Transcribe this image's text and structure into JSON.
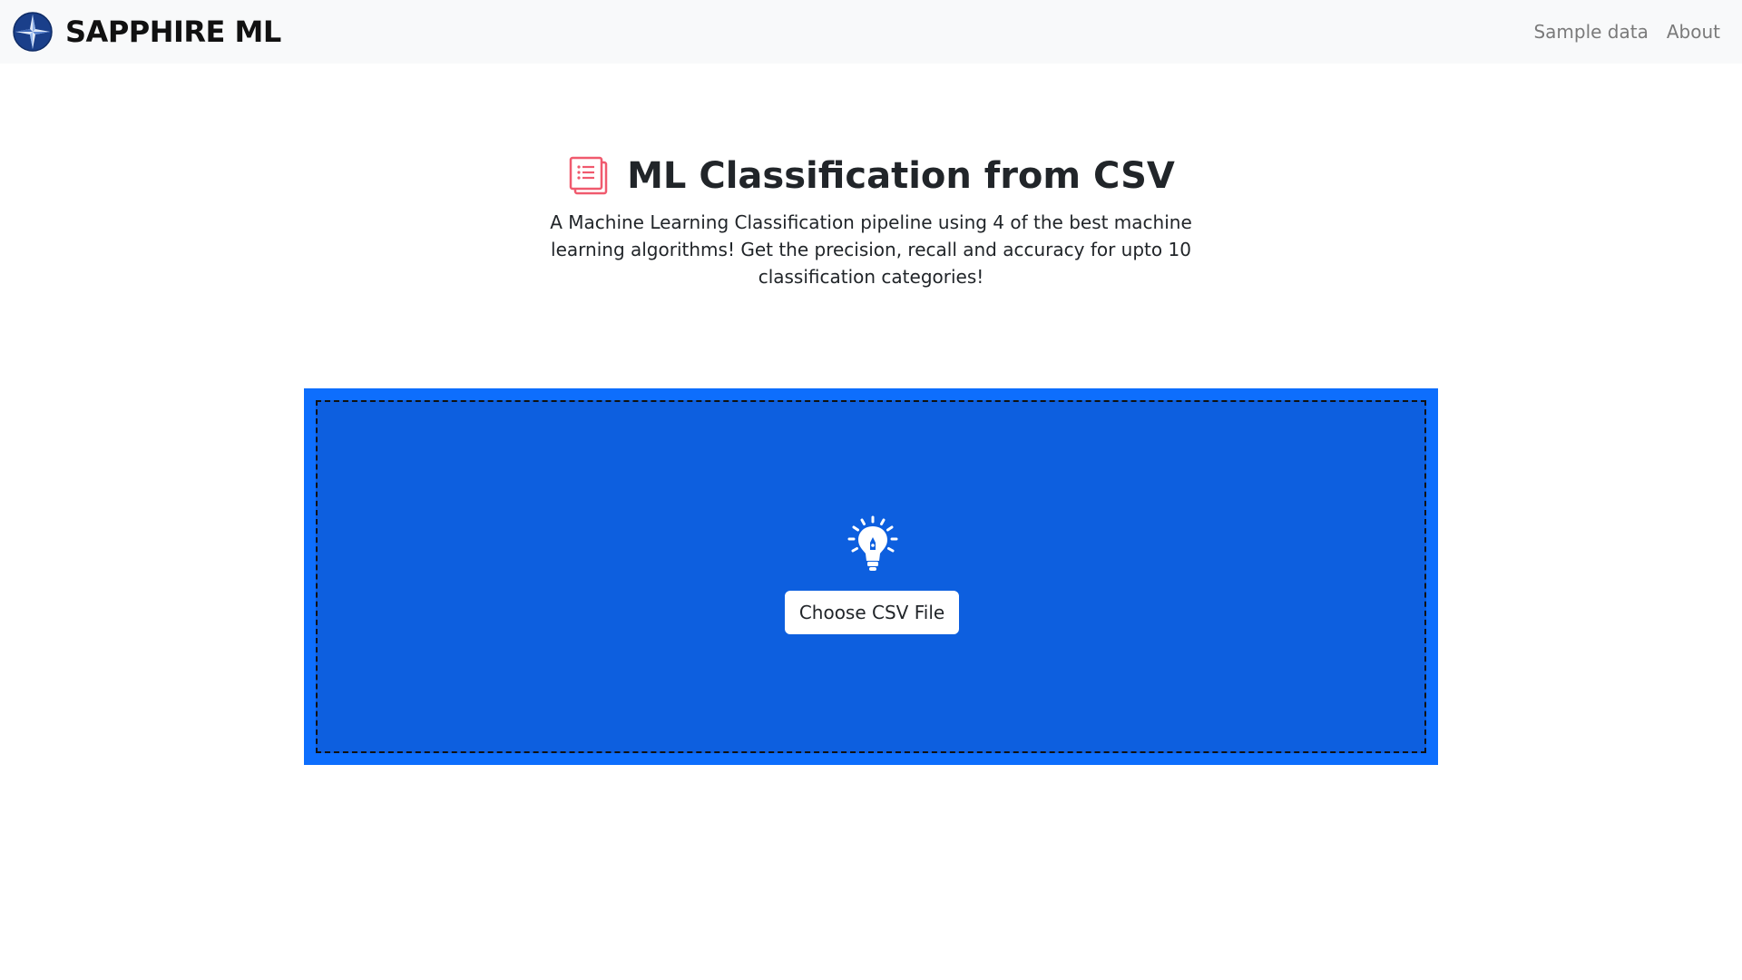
{
  "navbar": {
    "brand_text": "SAPPHIRE ML",
    "logo_icon": "sapphire-star-logo",
    "links": [
      {
        "label": "Sample data"
      },
      {
        "label": "About"
      }
    ]
  },
  "hero": {
    "icon": "document-list-icon",
    "title": "ML Classification from CSV",
    "subtitle": "A Machine Learning Classification pipeline using 4 of the best machine learning algorithms! Get the precision, recall and accuracy for upto 10 classification categories!"
  },
  "upload": {
    "icon": "lightbulb-icon",
    "button_label": "Choose CSV File"
  },
  "colors": {
    "accent": "#0d6efd",
    "dropzone_fill": "#0d5fdf",
    "title_icon": "#f05a6e",
    "navbar_bg": "#f8f9fa"
  }
}
